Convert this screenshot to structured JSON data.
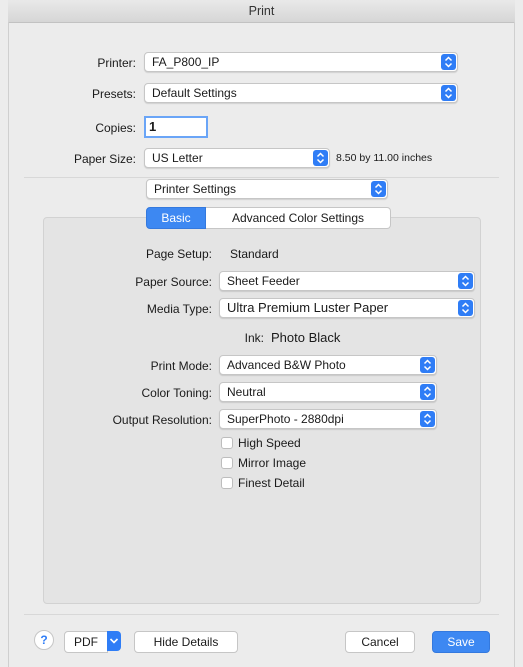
{
  "window": {
    "title": "Print"
  },
  "printer": {
    "label": "Printer:",
    "value": "FA_P800_IP"
  },
  "presets": {
    "label": "Presets:",
    "value": "Default Settings"
  },
  "copies": {
    "label": "Copies:",
    "value": "1"
  },
  "paper_size": {
    "label": "Paper Size:",
    "value": "US Letter",
    "dimensions": "8.50 by 11.00 inches"
  },
  "section_popup": {
    "value": "Printer Settings"
  },
  "tabs": [
    {
      "label": "Basic",
      "selected": true
    },
    {
      "label": "Advanced Color Settings",
      "selected": false
    }
  ],
  "basic": {
    "page_setup": {
      "label": "Page Setup:",
      "value": "Standard"
    },
    "paper_source": {
      "label": "Paper Source:",
      "value": "Sheet Feeder"
    },
    "media_type": {
      "label": "Media Type:",
      "value": "Ultra Premium Luster Paper"
    },
    "ink": {
      "label": "Ink:",
      "value": "Photo Black"
    },
    "print_mode": {
      "label": "Print Mode:",
      "value": "Advanced B&W Photo"
    },
    "color_toning": {
      "label": "Color Toning:",
      "value": "Neutral"
    },
    "output_resolution": {
      "label": "Output Resolution:",
      "value": "SuperPhoto - 2880dpi"
    },
    "checkboxes": [
      {
        "label": "High Speed",
        "checked": false
      },
      {
        "label": "Mirror Image",
        "checked": false
      },
      {
        "label": "Finest Detail",
        "checked": false
      }
    ]
  },
  "footer": {
    "help_label": "?",
    "pdf_label": "PDF",
    "hide_details_label": "Hide Details",
    "cancel_label": "Cancel",
    "save_label": "Save"
  },
  "colors": {
    "accent": "#2f7df6",
    "selected_segment": "#3d88f2",
    "panel": "#e4e4e4",
    "window": "#ececec"
  },
  "icons": {
    "popup_arrows": "updown-chevron-icon",
    "pdf_menu": "chevron-down-icon",
    "help": "question-icon"
  }
}
